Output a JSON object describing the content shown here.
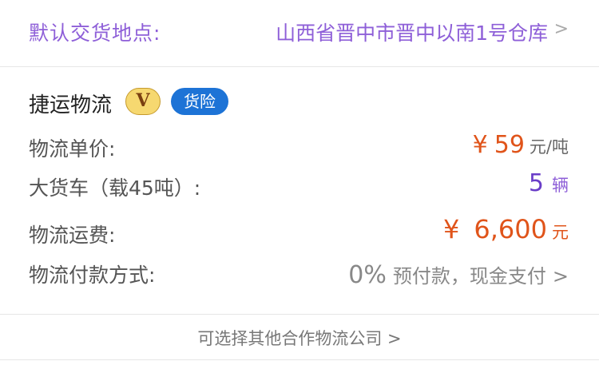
{
  "delivery": {
    "label": "默认交货地点:",
    "location": "山西省晋中市晋中以南1号仓库",
    "chevron": ">"
  },
  "carrier": {
    "name": "捷运物流",
    "vip_badge": "V",
    "insurance_badge": "货险",
    "colors": {
      "accent_purple": "#8e5fd8",
      "price_orange": "#e0541a",
      "badge_blue": "#1d73d6",
      "badge_gold": "#f6d870"
    }
  },
  "pricing": {
    "unit_price_label": "物流单价:",
    "unit_price_symbol": "¥",
    "unit_price_value": "59",
    "unit_price_unit": "元/吨",
    "truck_label": "大货车（载45吨）:",
    "truck_count": "5",
    "truck_unit": "辆",
    "fee_label": "物流运费:",
    "fee_symbol": "¥",
    "fee_value": "6,600",
    "fee_unit": "元",
    "payment_label": "物流付款方式:",
    "payment_percent": "0%",
    "payment_text": "预付款，现金支付",
    "payment_chevron": ">"
  },
  "footer": {
    "other_carriers_link": "可选择其他合作物流公司 >"
  }
}
